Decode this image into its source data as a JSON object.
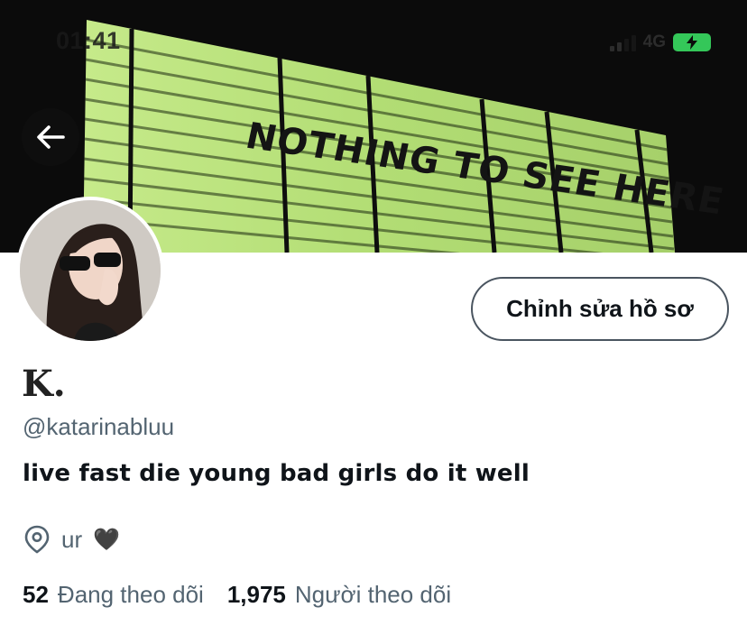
{
  "status_bar": {
    "time": "01:41",
    "network": "4G",
    "colors": {
      "battery": "#34c759"
    }
  },
  "banner": {
    "marquee_text": "NOTHING TO SEE HERE",
    "colors": {
      "sign": "#b7df7a",
      "background": "#0b0b0b"
    }
  },
  "header": {
    "back_icon": "arrow-left-icon"
  },
  "profile": {
    "edit_button_label": "Chỉnh sửa hồ sơ",
    "display_name": "K.",
    "handle": "@katarinabluu",
    "bio": "live fast die young bad girls do it well",
    "location": {
      "icon": "location-pin-icon",
      "text": "ur",
      "emoji": "🖤"
    },
    "following": {
      "count": "52",
      "label": "Đang theo dõi"
    },
    "followers": {
      "count": "1,975",
      "label": "Người theo dõi"
    }
  }
}
